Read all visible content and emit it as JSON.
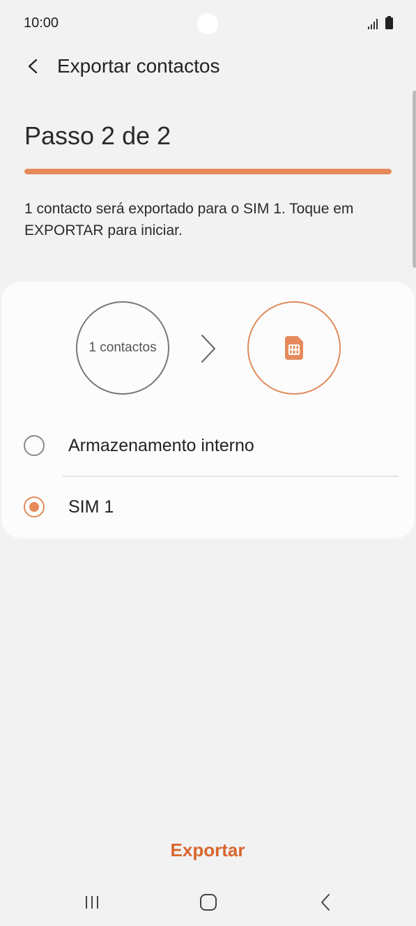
{
  "status_bar": {
    "time": "10:00",
    "icons": [
      "signal-icon",
      "battery-icon"
    ]
  },
  "app_bar": {
    "back_icon": "chevron-left-icon",
    "title": "Exportar contactos"
  },
  "step": {
    "title": "Passo 2 de 2",
    "progress_fraction": 1.0,
    "info": "1 contacto será exportado para o SIM 1. Toque em EXPORTAR para iniciar."
  },
  "card": {
    "source_label": "1 contactos",
    "arrow_icon": "chevron-right-icon",
    "target_icon": "sim-card-icon",
    "options": [
      {
        "label": "Armazenamento interno",
        "selected": false
      },
      {
        "label": "SIM 1",
        "selected": true
      }
    ]
  },
  "actions": {
    "export_label": "Exportar"
  },
  "nav_bar": {
    "icons": [
      "recent-apps-icon",
      "home-icon",
      "back-icon"
    ]
  },
  "colors": {
    "accent": "#e68a5c",
    "accent_text": "#d9662f",
    "background": "#f2f2f2",
    "card": "#fcfcfc"
  }
}
